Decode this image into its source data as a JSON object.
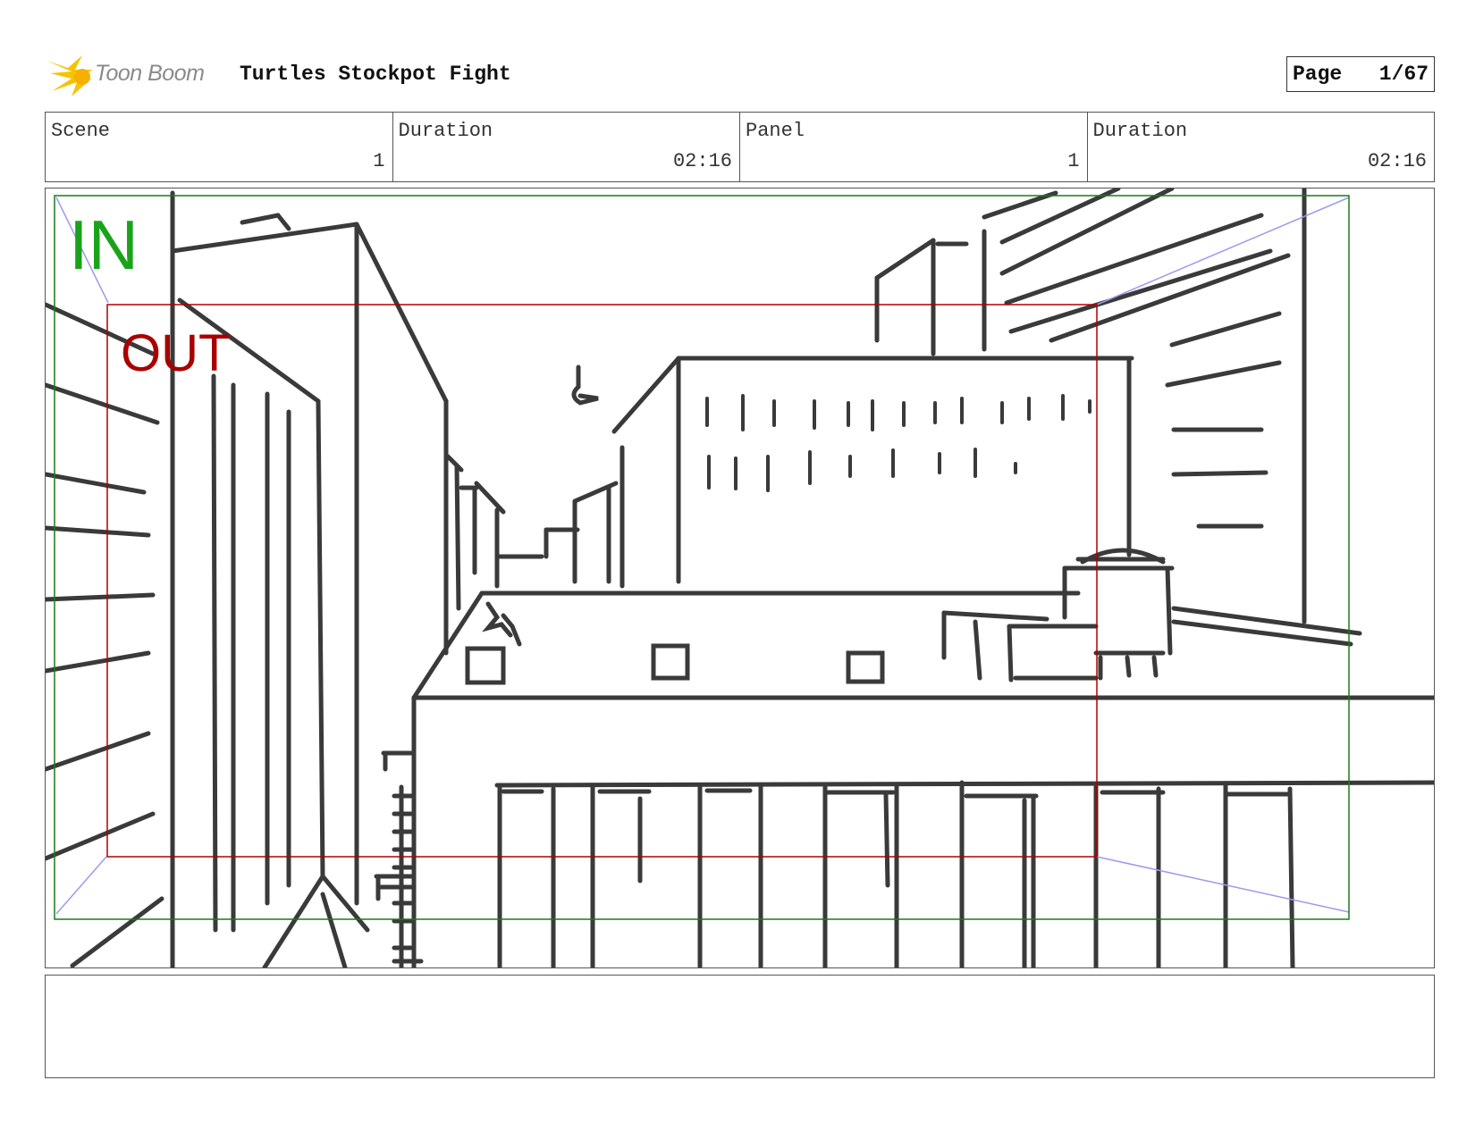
{
  "header": {
    "brand": "Toon Boom",
    "project_title": "Turtles Stockpot Fight",
    "page_label": "Page",
    "page_number": "1/67"
  },
  "info": {
    "scene_caption": "Scene",
    "scene_value": "1",
    "scene_duration_caption": "Duration",
    "scene_duration_value": "02:16",
    "panel_caption": "Panel",
    "panel_value": "1",
    "panel_duration_caption": "Duration",
    "panel_duration_value": "02:16"
  },
  "panel": {
    "in_label": "IN",
    "out_label": "OUT"
  },
  "colors": {
    "in_frame": "#1a7a1a",
    "out_frame": "#b00000",
    "sketch": "#3a3a3a",
    "camera_arrows": "#9a9af0",
    "logo_flash": "#f5c400"
  },
  "notes": {}
}
